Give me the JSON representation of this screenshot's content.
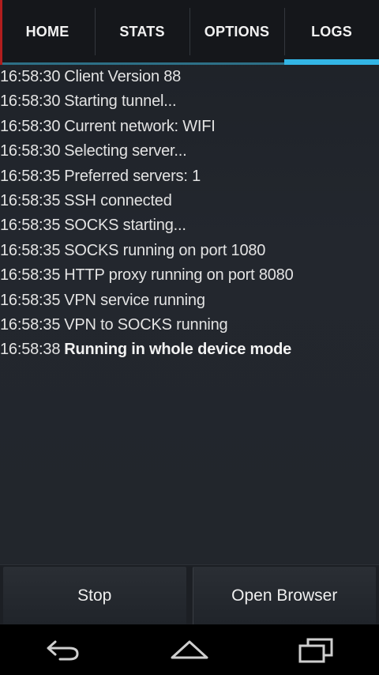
{
  "tabs": [
    {
      "label": "HOME",
      "active": false
    },
    {
      "label": "STATS",
      "active": false
    },
    {
      "label": "OPTIONS",
      "active": false
    },
    {
      "label": "LOGS",
      "active": true
    }
  ],
  "log": [
    {
      "time": "16:58:30",
      "message": "Client Version 88",
      "bold": false
    },
    {
      "time": "16:58:30",
      "message": "Starting tunnel...",
      "bold": false
    },
    {
      "time": "16:58:30",
      "message": "Current network: WIFI",
      "bold": false
    },
    {
      "time": "16:58:30",
      "message": "Selecting server...",
      "bold": false
    },
    {
      "time": "16:58:35",
      "message": "Preferred servers: 1",
      "bold": false
    },
    {
      "time": "16:58:35",
      "message": "SSH connected",
      "bold": false
    },
    {
      "time": "16:58:35",
      "message": "SOCKS starting...",
      "bold": false
    },
    {
      "time": "16:58:35",
      "message": "SOCKS running on port 1080",
      "bold": false
    },
    {
      "time": "16:58:35",
      "message": "HTTP proxy running on port 8080",
      "bold": false
    },
    {
      "time": "16:58:35",
      "message": "VPN service running",
      "bold": false
    },
    {
      "time": "16:58:35",
      "message": "VPN to SOCKS running",
      "bold": false
    },
    {
      "time": "16:58:38",
      "message": "Running in whole device mode",
      "bold": true
    }
  ],
  "buttons": {
    "stop_label": "Stop",
    "open_browser_label": "Open Browser"
  },
  "navbar": {
    "back_icon": "back-icon",
    "home_icon": "home-icon",
    "recents_icon": "recents-icon"
  },
  "colors": {
    "accent": "#33b5e5",
    "tab_background": "#15171b",
    "screen_background": "#22262c"
  }
}
